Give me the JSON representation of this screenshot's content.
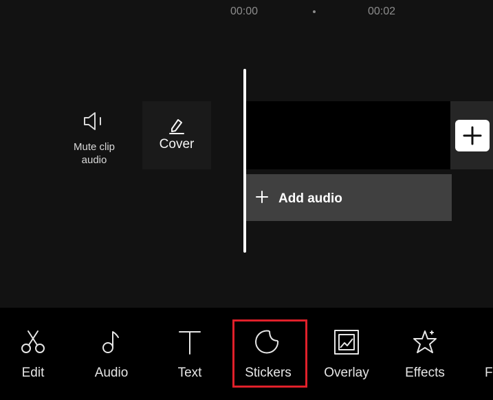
{
  "timeline": {
    "times": [
      "00:00",
      "00:02"
    ]
  },
  "clip_tools": {
    "mute_label": "Mute clip audio",
    "cover_label": "Cover"
  },
  "tracks": {
    "add_audio_label": "Add audio"
  },
  "toolbar": {
    "items": [
      {
        "label": "Edit",
        "icon": "scissors-icon"
      },
      {
        "label": "Audio",
        "icon": "music-note-icon"
      },
      {
        "label": "Text",
        "icon": "text-icon"
      },
      {
        "label": "Stickers",
        "icon": "sticker-icon",
        "selected": true
      },
      {
        "label": "Overlay",
        "icon": "overlay-icon"
      },
      {
        "label": "Effects",
        "icon": "sparkle-star-icon"
      },
      {
        "label": "Fi",
        "icon": "filter-icon"
      }
    ]
  },
  "colors": {
    "background": "#121212",
    "toolbar": "#000000",
    "highlight": "#e0202a"
  }
}
